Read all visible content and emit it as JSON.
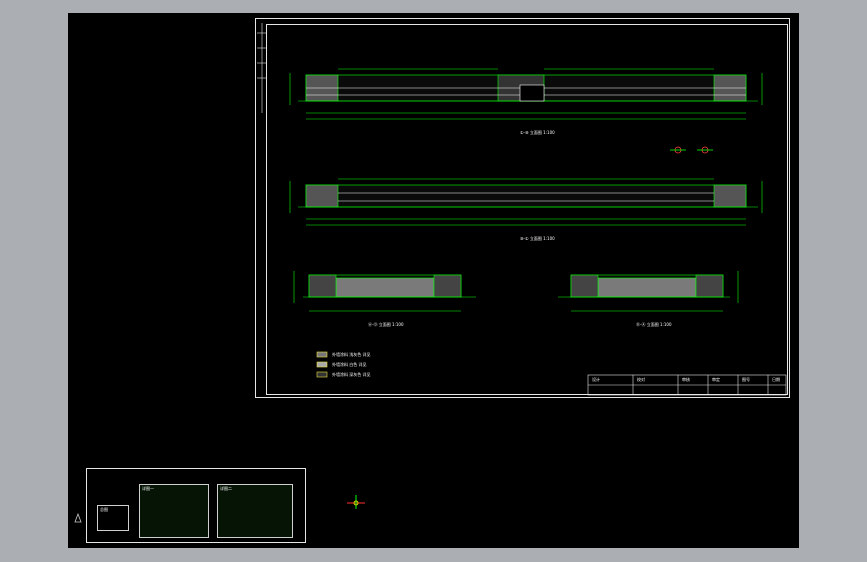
{
  "app": {
    "background": "#abaeb2",
    "canvas_background": "#000000"
  },
  "colors": {
    "lines": "#00ff00",
    "frame": "#e6e6e6",
    "text": "#ffffff",
    "accent": "#ffff00",
    "hatch": "#9a9a9a"
  },
  "elevations": {
    "elev1_caption": "①-⑩ 立面图 1:100",
    "elev2_caption": "⑩-① 立面图 1:100",
    "elev3_caption": "Ⓐ-Ⓓ 立面图 1:100",
    "elev4_caption": "Ⓓ-Ⓐ 立面图 1:100"
  },
  "legend": {
    "items": [
      {
        "label": "外墙涂料 浅灰色 详见"
      },
      {
        "label": "外墙涂料 白色 详见"
      },
      {
        "label": "外墙涂料 深灰色 详见"
      }
    ]
  },
  "title_block": {
    "cells": [
      "设计",
      "校对",
      "审核",
      "审定",
      "图号",
      "日期"
    ]
  },
  "thumbnails": {
    "labels": [
      "总图",
      "详图一",
      "详图二"
    ]
  },
  "icons": [
    "ucs-icon",
    "north-arrow-icon"
  ]
}
